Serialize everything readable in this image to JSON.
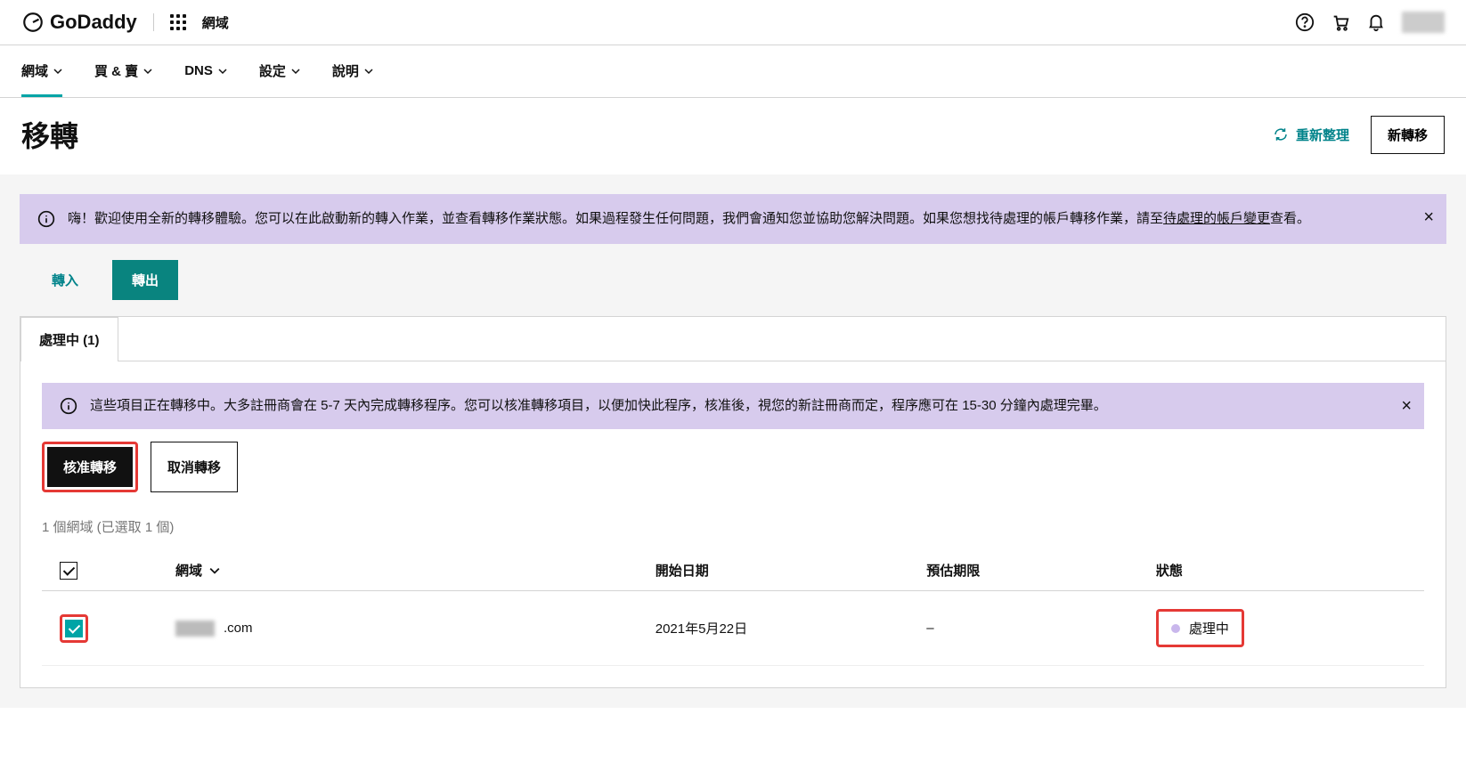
{
  "topbar": {
    "brand": "GoDaddy",
    "section_label": "網域"
  },
  "subnav": {
    "items": [
      {
        "label": "網域",
        "active": true
      },
      {
        "label": "買 & 賣"
      },
      {
        "label": "DNS"
      },
      {
        "label": "設定"
      },
      {
        "label": "說明"
      }
    ]
  },
  "page": {
    "title": "移轉",
    "refresh_label": "重新整理",
    "new_transfer_label": "新轉移"
  },
  "banner_main": {
    "text_prefix": "嗨！歡迎使用全新的轉移體驗。您可以在此啟動新的轉入作業，並查看轉移作業狀態。如果過程發生任何問題，我們會通知您並協助您解決問題。如果您想找待處理的帳戶轉移作業，請至",
    "link_text": "待處理的帳戶變更",
    "text_suffix": "查看。"
  },
  "tabs": {
    "in_label": "轉入",
    "out_label": "轉出"
  },
  "card": {
    "tab_label": "處理中 (1)",
    "inner_banner": "這些項目正在轉移中。大多註冊商會在 5-7 天內完成轉移程序。您可以核准轉移項目，以便加快此程序，核准後，視您的新註冊商而定，程序應可在 15-30 分鐘內處理完畢。",
    "approve_label": "核准轉移",
    "cancel_label": "取消轉移",
    "selection_text": "1 個網域 (已選取 1 個)"
  },
  "table": {
    "headers": {
      "domain": "網域",
      "start": "開始日期",
      "est": "預估期限",
      "status": "狀態"
    },
    "rows": [
      {
        "domain_suffix": ".com",
        "start": "2021年5月22日",
        "est": "–",
        "status": "處理中",
        "checked": true
      }
    ]
  }
}
